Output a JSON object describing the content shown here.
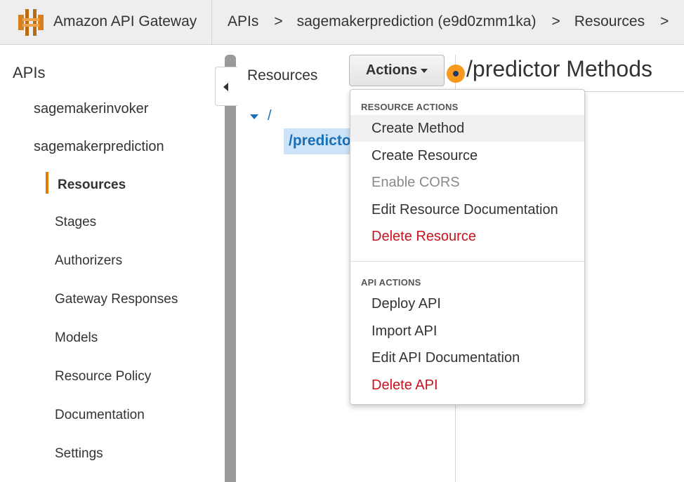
{
  "header": {
    "brand": "Amazon API Gateway",
    "breadcrumbs": [
      "APIs",
      "sagemakerprediction (e9d0zmm1ka)",
      "Resources"
    ],
    "separator": ">"
  },
  "sidebar": {
    "title": "APIs",
    "apis": [
      "sagemakerinvoker",
      "sagemakerprediction"
    ],
    "items": [
      {
        "label": "Resources",
        "active": true
      },
      {
        "label": "Stages"
      },
      {
        "label": "Authorizers"
      },
      {
        "label": "Gateway Responses"
      },
      {
        "label": "Models"
      },
      {
        "label": "Resource Policy"
      },
      {
        "label": "Documentation"
      },
      {
        "label": "Settings"
      }
    ]
  },
  "resources": {
    "title": "Resources",
    "actions_label": "Actions",
    "tree_root": "/",
    "tree_selected": "/predictor"
  },
  "methods": {
    "title": "/predictor Methods"
  },
  "actions_menu": {
    "resource_header": "RESOURCE ACTIONS",
    "resource_items": [
      "Create Method",
      "Create Resource",
      "Enable CORS",
      "Edit Resource Documentation",
      "Delete Resource"
    ],
    "api_header": "API ACTIONS",
    "api_items": [
      "Deploy API",
      "Import API",
      "Edit API Documentation",
      "Delete API"
    ]
  },
  "colors": {
    "accent": "#e07b00",
    "link": "#1a6fb5",
    "danger": "#c7131f",
    "hotspot": "#f7991c"
  }
}
